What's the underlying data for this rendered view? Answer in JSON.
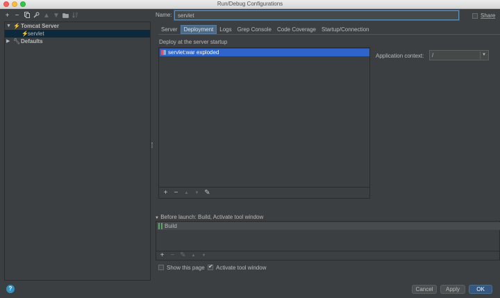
{
  "window": {
    "title": "Run/Debug Configurations"
  },
  "left_toolbar": {
    "icons": [
      "add-icon",
      "remove-icon",
      "copy-icon",
      "wrench-icon",
      "move-up-icon",
      "move-down-icon",
      "folder-icon",
      "sort-icon"
    ],
    "add": "+",
    "remove": "−"
  },
  "tree": {
    "group_label": "Tomcat Server",
    "child_label": "servlet",
    "defaults_label": "Defaults"
  },
  "form": {
    "name_label": "Name:",
    "name_value": "servlet",
    "share_label": "Share"
  },
  "tabs": [
    "Server",
    "Deployment",
    "Logs",
    "Grep Console",
    "Code Coverage",
    "Startup/Connection"
  ],
  "active_tab": "Deployment",
  "deployment": {
    "section_title": "Deploy at the server startup",
    "items": [
      "servlet:war exploded"
    ],
    "toolbar": [
      "+",
      "−",
      "▲",
      "▼",
      "✎"
    ]
  },
  "application_context": {
    "label": "Application context:",
    "value": "/"
  },
  "before_launch": {
    "title": "Before launch: Build, Activate tool window",
    "items": [
      "Build"
    ],
    "toolbar": [
      "+",
      "−",
      "✎",
      "▲",
      "▼"
    ]
  },
  "options": {
    "show_this_page": "Show this page",
    "show_this_page_checked": false,
    "activate_tool_window": "Activate tool window",
    "activate_tool_window_checked": true
  },
  "buttons": {
    "cancel": "Cancel",
    "apply": "Apply",
    "ok": "OK",
    "help": "?"
  },
  "colors": {
    "selection": "#2f65ca",
    "tree_selection": "#0d293e",
    "accent": "#365880",
    "tab_active": "#4b6a88"
  }
}
